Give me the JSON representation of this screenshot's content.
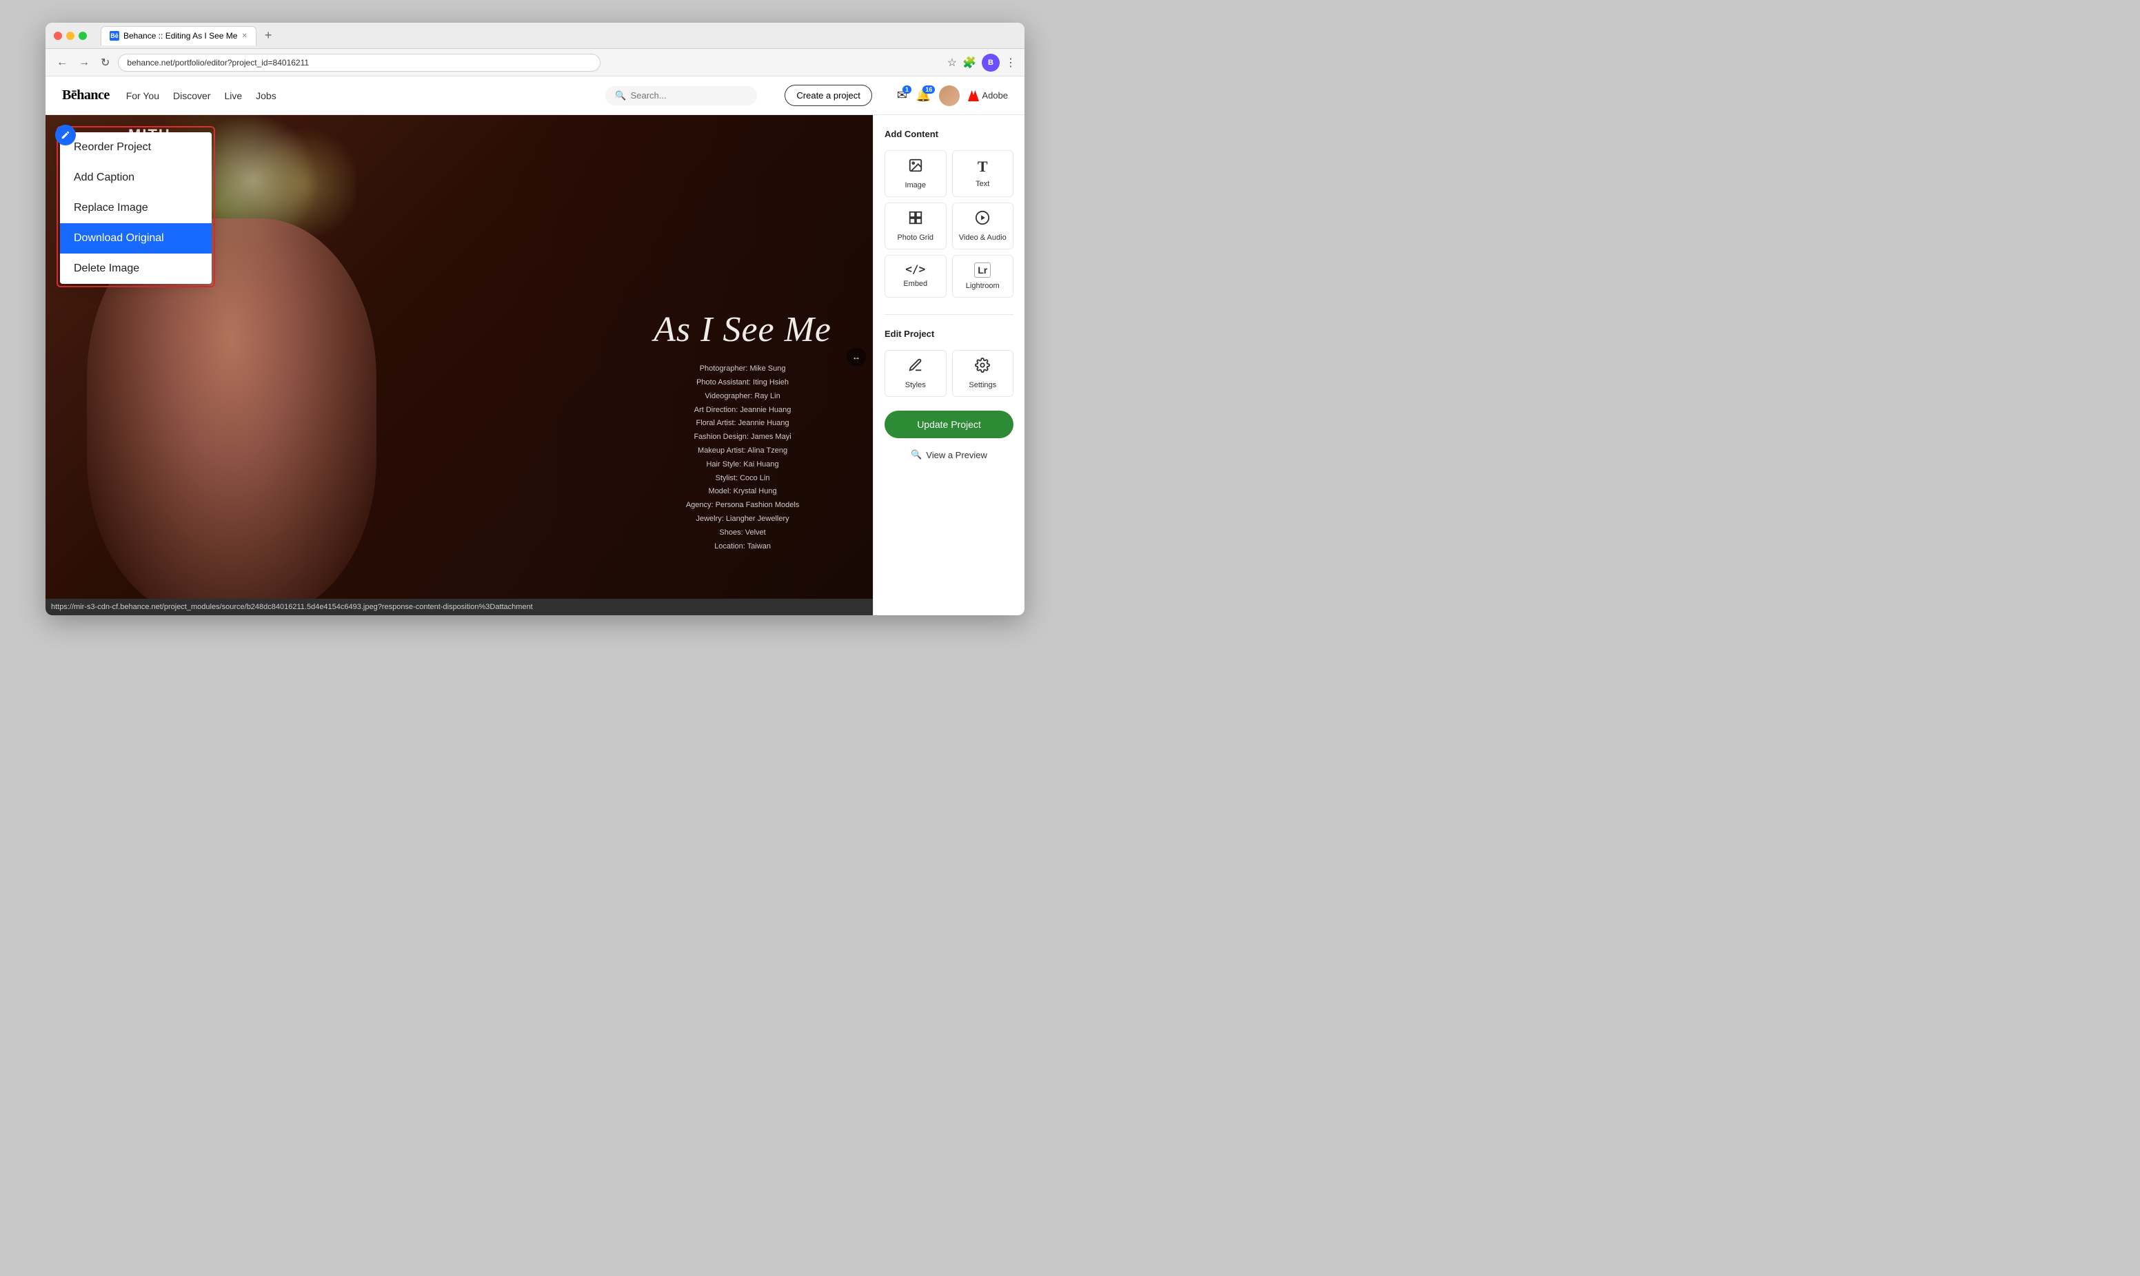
{
  "browser": {
    "tab_label": "Behance :: Editing As I See Me",
    "tab_new": "+",
    "address": "behance.net/portfolio/editor?project_id=84016211",
    "nav_back": "←",
    "nav_forward": "→",
    "nav_refresh": "↻",
    "status_url": "https://mir-s3-cdn-cf.behance.net/project_modules/source/b248dc84016211.5d4e4154c6493.jpeg?response-content-disposition%3Dattachment"
  },
  "header": {
    "logo": "Bēhance",
    "nav": [
      "For You",
      "Discover",
      "Live",
      "Jobs"
    ],
    "search_placeholder": "Search...",
    "create_btn": "Create a project",
    "notif1_badge": "1",
    "notif2_badge": "16",
    "adobe_label": "Adobe"
  },
  "context_menu": {
    "items": [
      {
        "label": "Reorder Project",
        "active": false
      },
      {
        "label": "Add Caption",
        "active": false
      },
      {
        "label": "Replace Image",
        "active": false
      },
      {
        "label": "Download Original",
        "active": true
      },
      {
        "label": "Delete Image",
        "active": false
      }
    ]
  },
  "image": {
    "title": "As I See Me",
    "brand": "MITH",
    "credits": [
      "Photographer: Mike Sung",
      "Photo Assistant: Iting Hsieh",
      "Videographer: Ray Lin",
      "Art Direction: Jeannie Huang",
      "Floral Artist: Jeannie Huang",
      "Fashion Design: James Mayi",
      "Makeup Artist: Alina Tzeng",
      "Hair Style: Kai Huang",
      "Stylist: Coco Lin",
      "Model: Krystal Hung",
      "Agency: Persona Fashion Models",
      "Jewelry: Liangher Jewellery",
      "Shoes: Velvet",
      "Location: Taiwan"
    ]
  },
  "sidebar": {
    "add_content_title": "Add Content",
    "edit_project_title": "Edit Project",
    "items": [
      {
        "label": "Image",
        "icon": "🖼"
      },
      {
        "label": "Text",
        "icon": "T"
      },
      {
        "label": "Photo Grid",
        "icon": "⊞"
      },
      {
        "label": "Video & Audio",
        "icon": "▶"
      },
      {
        "label": "Embed",
        "icon": "</>"
      },
      {
        "label": "Lightroom",
        "icon": "Lr"
      }
    ],
    "edit_items": [
      {
        "label": "Styles",
        "icon": "✏"
      },
      {
        "label": "Settings",
        "icon": "⚙"
      }
    ],
    "update_btn": "Update Project",
    "preview_link": "View a Preview"
  }
}
